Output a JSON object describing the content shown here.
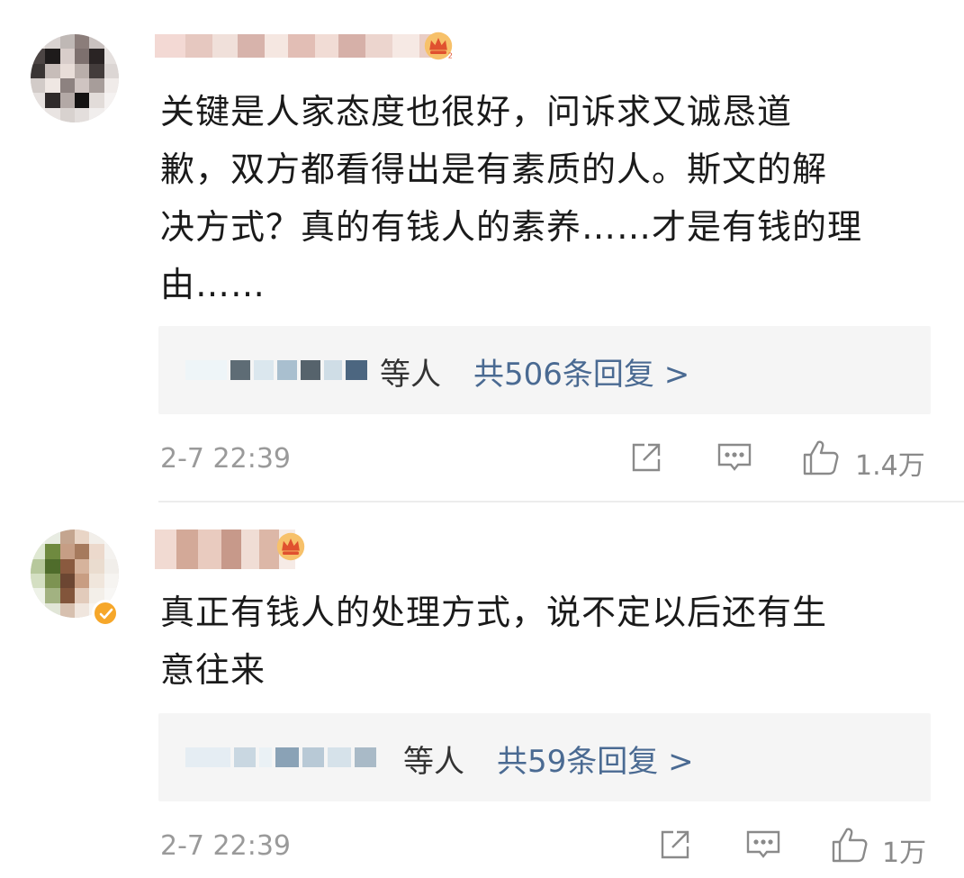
{
  "comments": [
    {
      "text": "关键是人家态度也很好，问诉求又诚恳道歉，双方都看得出是有素质的人。斯文的解决方式？真的有钱人的素养……才是有钱的理由……",
      "lines": [
        "关键是人家态度也很好，问诉求又诚恳道",
        "歉，双方都看得出是有素质的人。斯文的解",
        "决方式？真的有钱人的素养……才是有钱的理",
        "由……"
      ],
      "reply_suffix": "等人",
      "reply_count_label": "共506条回复 >",
      "timestamp": "2-7 22:39",
      "like_count": "1.4万",
      "icons": [
        "share-icon",
        "comment-icon",
        "like-icon"
      ]
    },
    {
      "text": "真正有钱人的处理方式，说不定以后还有生意往来",
      "lines": [
        "真正有钱人的处理方式，说不定以后还有生",
        "意往来"
      ],
      "reply_suffix": "等人",
      "reply_count_label": "共59条回复 >",
      "timestamp": "2-7 22:39",
      "like_count": "1万",
      "icons": [
        "share-icon",
        "comment-icon",
        "like-icon"
      ]
    }
  ],
  "colors": {
    "link_blue": "#4a6a92",
    "meta_gray": "#9a9a9a",
    "reply_bg": "#f5f5f5",
    "crown_gold": "#f0a23a",
    "verified_orange": "#f6a72a"
  }
}
